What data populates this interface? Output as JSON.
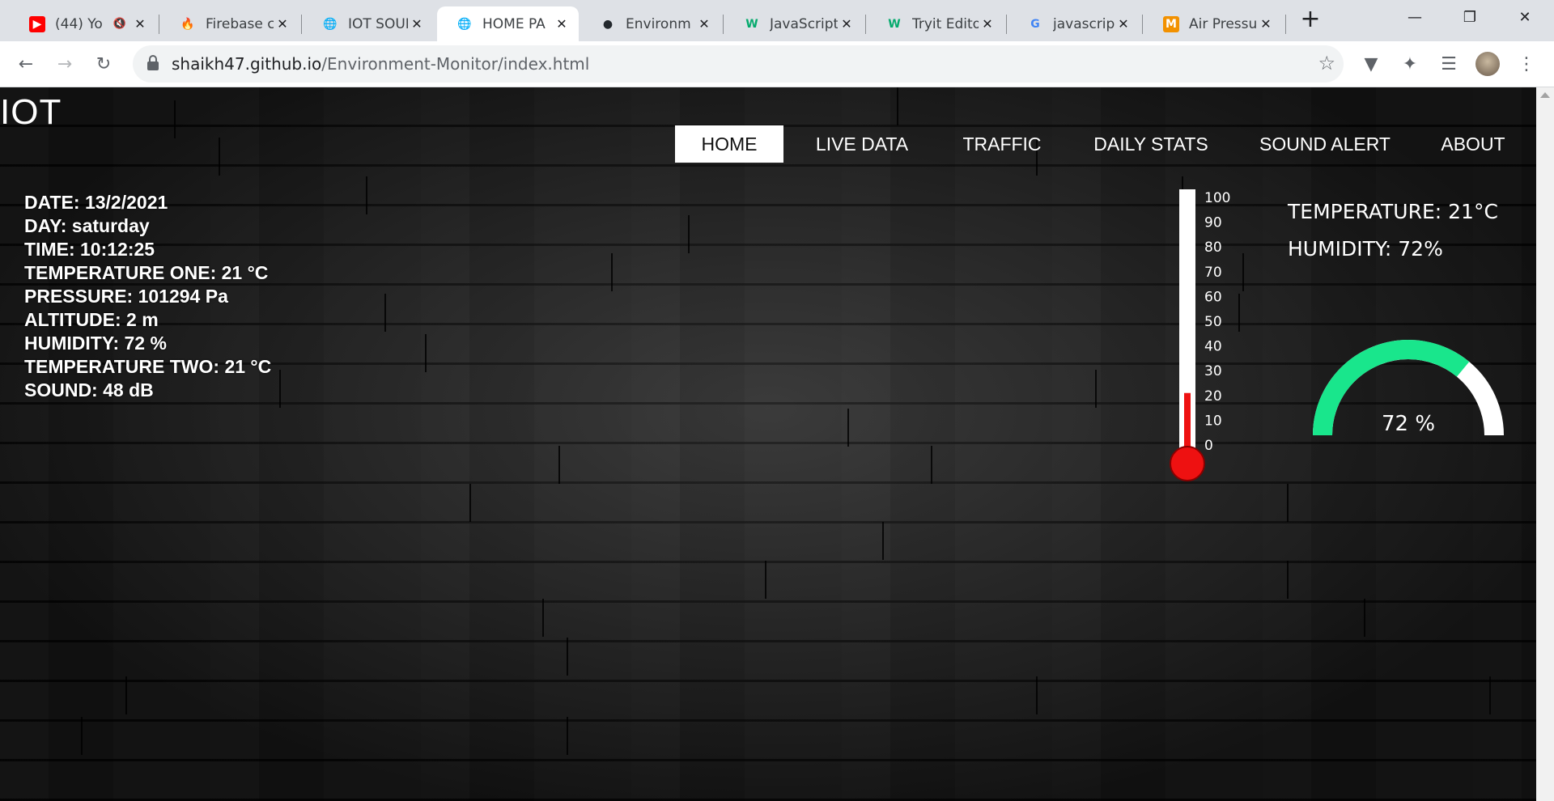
{
  "browser": {
    "tabs": [
      {
        "title": "(44) Yo",
        "icon": "youtube-icon",
        "muted": true
      },
      {
        "title": "Firebase c",
        "icon": "firebase-icon"
      },
      {
        "title": "IOT SOUN",
        "icon": "globe-icon"
      },
      {
        "title": "HOME PA",
        "icon": "globe-icon",
        "active": true
      },
      {
        "title": "Environm",
        "icon": "github-icon"
      },
      {
        "title": "JavaScript",
        "icon": "w3schools-icon"
      },
      {
        "title": "Tryit Edito",
        "icon": "w3schools-icon"
      },
      {
        "title": "javascript",
        "icon": "google-icon"
      },
      {
        "title": "Air Pressu",
        "icon": "mobiler-icon"
      }
    ],
    "address": {
      "host": "shaikh47.github.io",
      "path": "/Environment-Monitor/index.html"
    }
  },
  "site": {
    "logo": "IOT",
    "nav": [
      "HOME",
      "LIVE DATA",
      "TRAFFIC",
      "DAILY STATS",
      "SOUND ALERT",
      "ABOUT"
    ],
    "active_nav": "HOME"
  },
  "readings": [
    "DATE: 13/2/2021",
    "DAY: saturday",
    "TIME: 10:12:25",
    "TEMPERATURE ONE: 21 °C",
    "PRESSURE: 101294 Pa",
    "ALTITUDE: 2 m",
    "HUMIDITY: 72 %",
    "TEMPERATURE TWO: 21 °C",
    "SOUND: 48 dB"
  ],
  "summary": {
    "temperature": "TEMPERATURE: 21°C",
    "humidity": "HUMIDITY: 72%"
  },
  "thermometer": {
    "value": 21,
    "min": 0,
    "max": 100,
    "ticks": [
      "100",
      "90",
      "80",
      "70",
      "60",
      "50",
      "40",
      "30",
      "20",
      "10",
      "0"
    ],
    "fill_color": "#ee1111"
  },
  "gauge": {
    "value": 72,
    "label": "72 %",
    "fill_color": "#19e68c",
    "track_color": "#ffffff"
  }
}
